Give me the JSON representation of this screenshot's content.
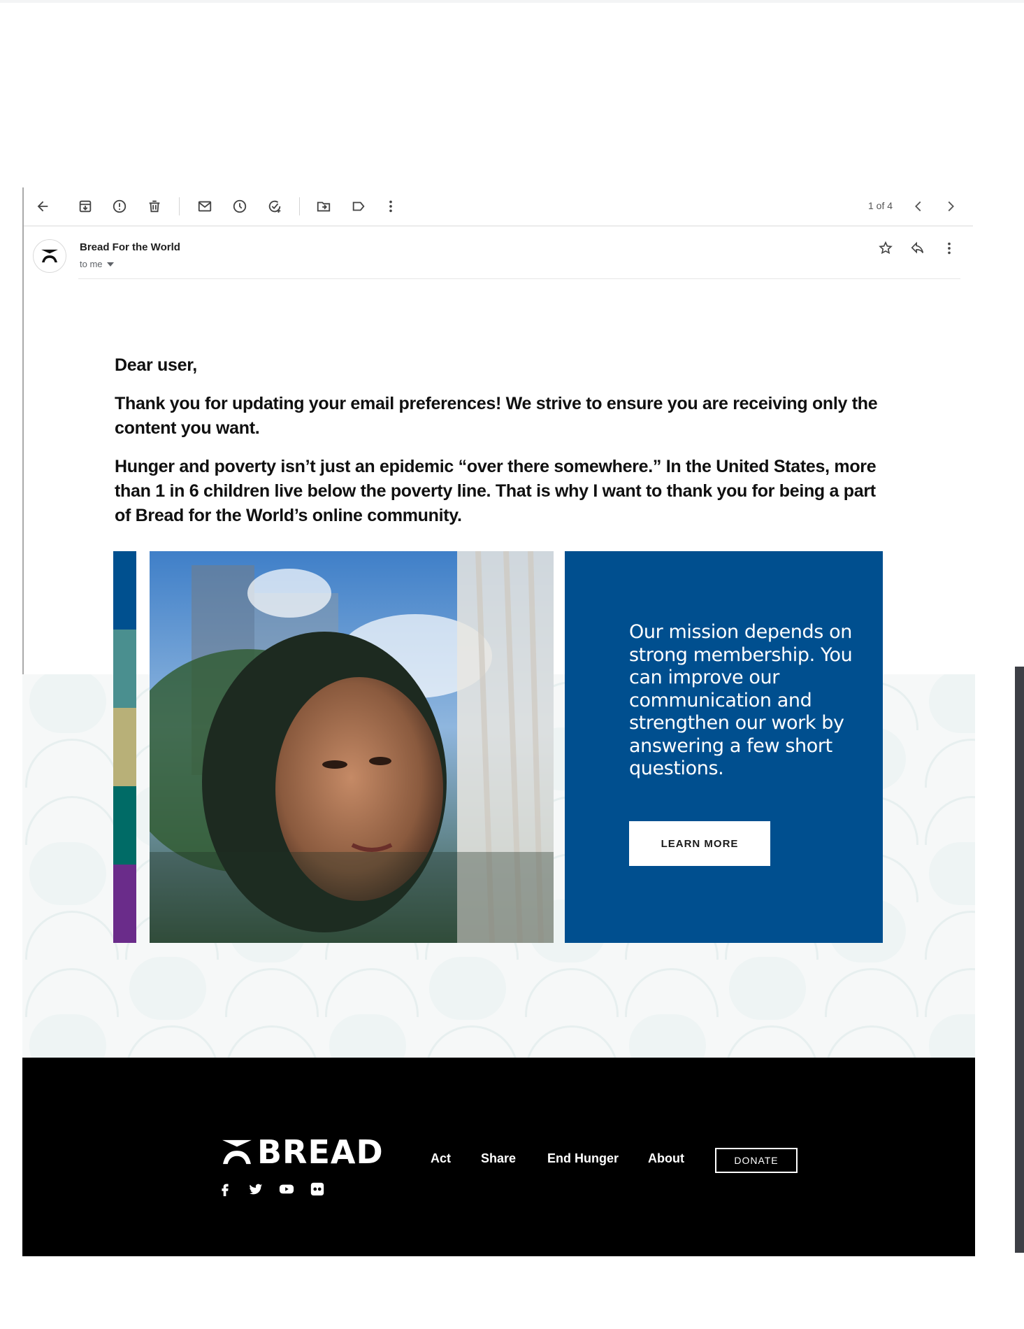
{
  "toolbar": {
    "icons": [
      "back-arrow-icon",
      "archive-icon",
      "report-spam-icon",
      "delete-icon",
      "mark-unread-icon",
      "snooze-icon",
      "add-to-tasks-icon",
      "move-to-icon",
      "label-icon",
      "more-vert-icon"
    ],
    "pager": "1 of 4"
  },
  "sender": {
    "name": "Bread For the World",
    "to": "to me"
  },
  "email": {
    "greeting": "Dear user,",
    "paragraph1": "Thank you for updating your email preferences! We strive to ensure you are receiving only the content you want.",
    "paragraph2": "Hunger and poverty isn’t just an epidemic “over there somewhere.” In the United States, more than 1 in 6 children live below the poverty line. That is why I want to thank you for being a part of Bread for the World’s online community."
  },
  "feature": {
    "stripe_colors": [
      "#00508f",
      "#4a8f8f",
      "#b8b078",
      "#006b66",
      "#6a2c8a"
    ],
    "card_color": "#004f8f",
    "mission_text": "Our mission depends on strong membership. You can improve our communication and strengthen our work by answering a few short questions.",
    "cta_label": "LEARN MORE"
  },
  "footer": {
    "logo_text": "BREAD",
    "nav": [
      "Act",
      "Share",
      "End Hunger",
      "About"
    ],
    "donate_label": "DONATE",
    "socials": [
      "facebook-icon",
      "twitter-icon",
      "youtube-icon",
      "flickr-icon"
    ]
  }
}
